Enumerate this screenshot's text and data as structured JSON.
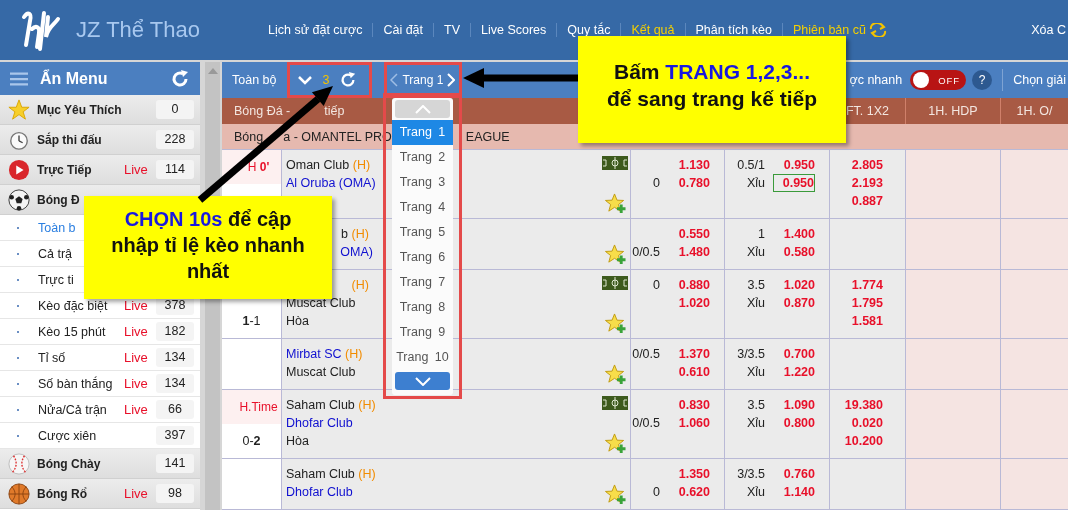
{
  "header": {
    "brand": "JZ Thể Thao",
    "nav": [
      {
        "label": "Lịch sử đặt cược",
        "highlighted": false
      },
      {
        "label": "Cài đặt",
        "highlighted": false
      },
      {
        "label": "TV",
        "highlighted": false
      },
      {
        "label": "Live Scores",
        "highlighted": false
      },
      {
        "label": "Quy tắc",
        "highlighted": false
      },
      {
        "label": "Kết quả",
        "highlighted": true
      },
      {
        "label": "Phân tích kèo",
        "highlighted": false
      },
      {
        "label": "Phiên bản cũ",
        "highlighted": true
      }
    ],
    "clear_label": "Xóa C"
  },
  "sidebar": {
    "title": "Ẩn Menu",
    "items": [
      {
        "kind": "sport",
        "label": "Mục Yêu Thích",
        "count": "0",
        "selected": false
      },
      {
        "kind": "sport",
        "label": "Sắp thi đấu",
        "count": "228",
        "selected": false
      },
      {
        "kind": "sport",
        "label": "Trực Tiếp",
        "badge": "Live",
        "count": "114",
        "selected": false
      },
      {
        "kind": "sport",
        "label": "Bóng Đ",
        "selected": false
      },
      {
        "kind": "sub",
        "label": "Toàn b",
        "selected": true
      },
      {
        "kind": "sub",
        "label": "Cả trậ",
        "selected": false
      },
      {
        "kind": "sub",
        "label": "Trực ti",
        "selected": false
      },
      {
        "kind": "sub",
        "label": "Kèo đặc biệt",
        "badge": "Live",
        "count": "378",
        "selected": false
      },
      {
        "kind": "sub",
        "label": "Kèo 15 phút",
        "badge": "Live",
        "count": "182",
        "selected": false
      },
      {
        "kind": "sub",
        "label": "Tỉ số",
        "badge": "Live",
        "count": "134",
        "selected": false
      },
      {
        "kind": "sub",
        "label": "Số bàn thắng",
        "badge": "Live",
        "count": "134",
        "selected": false
      },
      {
        "kind": "sub",
        "label": "Nửa/Cả trận",
        "badge": "Live",
        "count": "66",
        "selected": false
      },
      {
        "kind": "sub",
        "label": "Cược xiên",
        "count": "397",
        "selected": false
      },
      {
        "kind": "sport",
        "label": "Bóng Chày",
        "count": "141",
        "selected": false
      },
      {
        "kind": "sport",
        "label": "Bóng Rổ",
        "badge": "Live",
        "count": "98",
        "selected": false
      }
    ]
  },
  "toolbar": {
    "filter": "Toàn bộ",
    "refresh_interval": "3",
    "page": "Trang 1",
    "quick_bet_label": "ợc nhanh",
    "quick_bet": {
      "on": false,
      "label": "OFF"
    },
    "help": "?",
    "league_select": "Chọn giải"
  },
  "page_menu": {
    "items": [
      {
        "label": "Trang 1",
        "selected": true
      },
      {
        "label": "Trang 2",
        "selected": false
      },
      {
        "label": "Trang 3",
        "selected": false
      },
      {
        "label": "Trang 4",
        "selected": false
      },
      {
        "label": "Trang 5",
        "selected": false
      },
      {
        "label": "Trang 6",
        "selected": false
      },
      {
        "label": "Trang 7",
        "selected": false
      },
      {
        "label": "Trang 8",
        "selected": false
      },
      {
        "label": "Trang 9",
        "selected": false
      },
      {
        "label": "Trang 10",
        "selected": false
      }
    ]
  },
  "table": {
    "header_fragments": [
      "Bóng Đá -",
      "tiếp"
    ],
    "ft_1x2": "FT. 1X2",
    "h1_hdp": "1H. HDP",
    "h1_ou": "1H. O/",
    "league_fragments": [
      "Bóng",
      "a - OMANTEL PRO",
      "EAGUE"
    ],
    "rows": [
      {
        "time": "H **0'**",
        "home": {
          "name": "Oman Club",
          "highlighted": false,
          "cut": false
        },
        "home_marker": "(H)",
        "away": {
          "name": "Al Oruba (OMA)",
          "highlighted": true,
          "cut": false
        },
        "live_field": true,
        "hdp": [
          {
            "odds": "1.130",
            "outlined": false
          },
          {
            "line": "0",
            "odds": "0.780",
            "outlined": false
          }
        ],
        "ou": [
          {
            "line": "0.5/1",
            "odds": "0.950",
            "outlined": false
          },
          {
            "line": "Xỉu",
            "odds": "0.950",
            "outlined": true
          }
        ],
        "x12": [
          "2.805",
          "2.193",
          "0.887"
        ]
      },
      {
        "home": {
          "name": "b",
          "highlighted": false,
          "cut": true
        },
        "home_marker": "(H)",
        "away": {
          "name": "OMA)",
          "highlighted": true,
          "cut": true
        },
        "live_field": false,
        "hdp": [
          {
            "odds": "0.550",
            "outlined": false
          },
          {
            "line": "0/0.5",
            "odds": "1.480",
            "outlined": false
          }
        ],
        "ou": [
          {
            "line": "1",
            "odds": "1.400",
            "outlined": false
          },
          {
            "line": "Xỉu",
            "odds": "0.580",
            "outlined": false
          }
        ]
      },
      {
        "score": "**1**-1",
        "home": {
          "cut": true
        },
        "home_marker": "(H)",
        "away": {
          "name": "Muscat Club",
          "highlighted": false,
          "cut": false
        },
        "draw": "Hòa",
        "live_field": true,
        "hdp": [
          {
            "line": "0",
            "odds": "0.880",
            "outlined": false
          },
          {
            "odds": "1.020",
            "outlined": false
          }
        ],
        "ou": [
          {
            "line": "3.5",
            "odds": "1.020",
            "outlined": false
          },
          {
            "line": "Xỉu",
            "odds": "0.870",
            "outlined": false
          }
        ],
        "x12": [
          "1.774",
          "1.795",
          "1.581"
        ]
      },
      {
        "home": {
          "name": "Mirbat SC",
          "highlighted": true,
          "cut": false
        },
        "home_marker": "(H)",
        "away": {
          "name": "Muscat Club",
          "highlighted": false,
          "cut": false
        },
        "live_field": false,
        "hdp": [
          {
            "line": "0/0.5",
            "odds": "1.370",
            "outlined": false
          },
          {
            "odds": "0.610",
            "outlined": false
          }
        ],
        "ou": [
          {
            "line": "3/3.5",
            "odds": "0.700",
            "outlined": false
          },
          {
            "line": "Xỉu",
            "odds": "1.220",
            "outlined": false
          }
        ]
      },
      {
        "time": "H.Time",
        "score": "0-**2**",
        "home": {
          "name": "Saham Club",
          "highlighted": false,
          "cut": false
        },
        "home_marker": "(H)",
        "away": {
          "name": "Dhofar Club",
          "highlighted": true,
          "cut": false
        },
        "draw": "Hòa",
        "live_field": true,
        "hdp": [
          {
            "odds": "0.830",
            "outlined": false
          },
          {
            "line": "0/0.5",
            "odds": "1.060",
            "outlined": false
          }
        ],
        "ou": [
          {
            "line": "3.5",
            "odds": "1.090",
            "outlined": false
          },
          {
            "line": "Xỉu",
            "odds": "0.800",
            "outlined": false
          }
        ],
        "x12": [
          "19.380",
          "0.020",
          "10.200"
        ]
      },
      {
        "home": {
          "name": "Saham Club",
          "highlighted": false,
          "cut": false
        },
        "home_marker": "(H)",
        "away": {
          "name": "Dhofar Club",
          "highlighted": true,
          "cut": false
        },
        "live_field": false,
        "hdp": [
          {
            "odds": "1.350",
            "outlined": false
          },
          {
            "line": "0",
            "odds": "0.620",
            "outlined": false
          }
        ],
        "ou": [
          {
            "line": "3/3.5",
            "odds": "0.760",
            "outlined": false
          },
          {
            "line": "Xỉu",
            "odds": "1.140",
            "outlined": false
          }
        ]
      }
    ]
  },
  "annotations": [
    {
      "lines": [
        "**CHỌN 10s** để cập",
        "nhập tỉ lệ kèo nhanh",
        "nhất"
      ]
    },
    {
      "lines": [
        "Bấm **TRANG 1,2,3...**",
        "để sang trang kế tiếp"
      ]
    }
  ]
}
